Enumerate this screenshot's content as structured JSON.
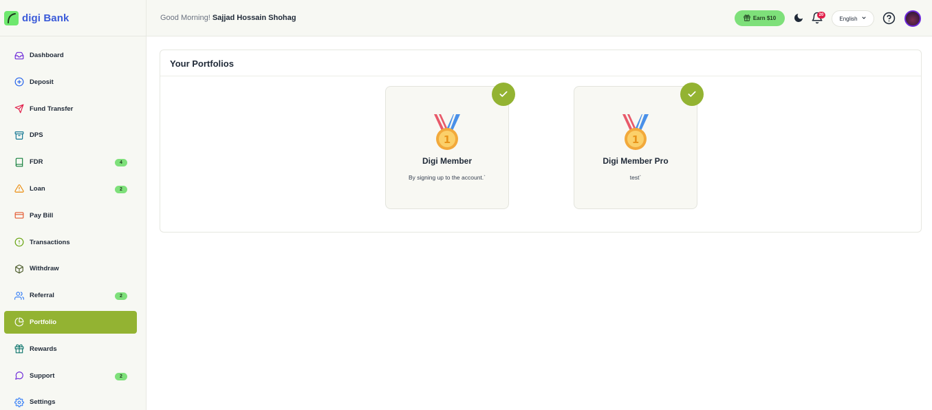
{
  "app": {
    "name": "digi Bank"
  },
  "header": {
    "greeting": "Good Morning!",
    "user_name": "Sajjad Hossain Shohag",
    "earn_label": "Earn $10",
    "notification_count": "20",
    "language": "English"
  },
  "sidebar": {
    "items": [
      {
        "label": "Dashboard",
        "icon": "inbox-icon",
        "badge": ""
      },
      {
        "label": "Deposit",
        "icon": "plus-circle-icon",
        "badge": ""
      },
      {
        "label": "Fund Transfer",
        "icon": "send-icon",
        "badge": ""
      },
      {
        "label": "DPS",
        "icon": "archive-icon",
        "badge": ""
      },
      {
        "label": "FDR",
        "icon": "book-icon",
        "badge": "4"
      },
      {
        "label": "Loan",
        "icon": "warning-icon",
        "badge": "2"
      },
      {
        "label": "Pay Bill",
        "icon": "credit-card-icon",
        "badge": ""
      },
      {
        "label": "Transactions",
        "icon": "alert-circle-icon",
        "badge": ""
      },
      {
        "label": "Withdraw",
        "icon": "box-icon",
        "badge": ""
      },
      {
        "label": "Referral",
        "icon": "users-icon",
        "badge": "2"
      },
      {
        "label": "Portfolio",
        "icon": "pie-chart-icon",
        "badge": ""
      },
      {
        "label": "Rewards",
        "icon": "gift-icon",
        "badge": ""
      },
      {
        "label": "Support",
        "icon": "message-circle-icon",
        "badge": "2"
      },
      {
        "label": "Settings",
        "icon": "gear-icon",
        "badge": ""
      }
    ],
    "active": "Portfolio"
  },
  "main": {
    "title": "Your Portfolios",
    "portfolios": [
      {
        "name": "Digi Member",
        "description": "By signing up to the account.`",
        "achieved": true
      },
      {
        "name": "Digi Member Pro",
        "description": "test`",
        "achieved": true
      }
    ]
  },
  "colors": {
    "accent": "#93b332",
    "earn_green": "#7ee07a",
    "brand_blue": "#3b5bd9",
    "badge_red": "#e11d48"
  }
}
